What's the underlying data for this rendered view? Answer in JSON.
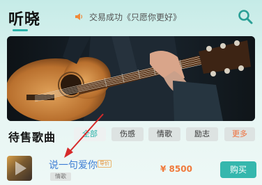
{
  "header": {
    "title": "听晓",
    "notice_icon": "speaker-icon",
    "notice_text": "交易成功《只愿你更好》",
    "search_icon": "search-icon"
  },
  "banner": {
    "image": "guitar-player-photo"
  },
  "section": {
    "title": "待售歌曲",
    "chips": [
      {
        "label": "全部",
        "active": true
      },
      {
        "label": "伤感",
        "active": false
      },
      {
        "label": "情歌",
        "active": false
      },
      {
        "label": "励志",
        "active": false
      },
      {
        "label": "更多",
        "active": false
      }
    ]
  },
  "song": {
    "title": "说一句爱你",
    "badge": "导价",
    "tag": "情歌",
    "price": "¥ 8500",
    "buy_label": "购买"
  },
  "colors": {
    "accent": "#35b7ad",
    "price": "#f07a3c",
    "link": "#3e7ed4",
    "annotation": "#d62a2a"
  }
}
